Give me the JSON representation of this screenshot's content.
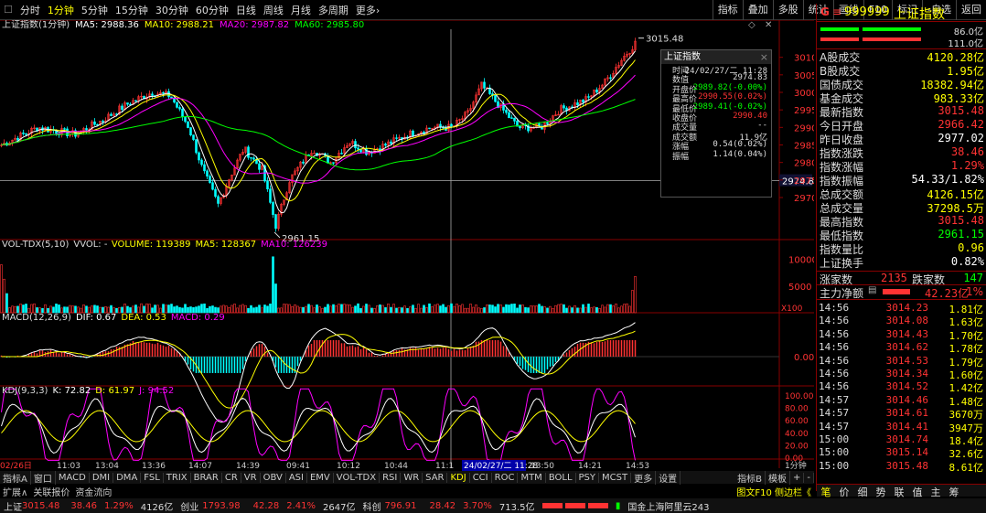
{
  "toolbar": {
    "periods": [
      "分时",
      "1分钟",
      "5分钟",
      "15分钟",
      "30分钟",
      "60分钟",
      "日线",
      "周线",
      "月线",
      "多周期",
      "更多›"
    ],
    "tools": [
      "指标",
      "叠加",
      "多股",
      "统计",
      "画线",
      "F10",
      "标记",
      "-自选",
      "返回"
    ]
  },
  "main_chart": {
    "title": "上证指数(1分钟)",
    "ma5": "MA5: 2988.36",
    "ma10": "MA10: 2988.21",
    "ma20": "MA20: 2987.82",
    "ma60": "MA60: 2985.80",
    "high_label": "3015.48",
    "low_label": "2961.15",
    "cursor_price": "2974.8",
    "y_ticks": [
      "3010",
      "3005",
      "3000",
      "2995",
      "2990",
      "2985",
      "2980",
      "2975",
      "2970"
    ]
  },
  "vol": {
    "title": "VOL-TDX(5,10)",
    "vvol": "VVOL: -",
    "volume": "VOLUME: 119389",
    "ma5": "MA5: 128367",
    "ma10": "MA10: 126239",
    "y_ticks": [
      "10000",
      "5000"
    ],
    "unit": "X100"
  },
  "macd": {
    "title": "MACD(12,26,9)",
    "dif": "DIF: 0.67",
    "dea": "DEA: 0.53",
    "macd": "MACD: 0.29",
    "y_ticks": [
      "0.00"
    ]
  },
  "kdj": {
    "title": "KDJ(9,3,3)",
    "k": "K: 72.82",
    "d": "D: 61.97",
    "j": "J: 94.52",
    "y_ticks": [
      "100.00",
      "80.00",
      "60.00",
      "40.00",
      "20.00",
      "0.00"
    ]
  },
  "time_axis": {
    "labels": [
      "02/26日",
      "11:03",
      "13:04",
      "13:36",
      "14:07",
      "14:39",
      "09:41",
      "10:12",
      "10:44",
      "11:1",
      "24/02/27/二 11:28",
      "13:50",
      "14:21",
      "14:53"
    ],
    "period": "1分钟"
  },
  "tooltip": {
    "title": "上证指数",
    "rows": [
      {
        "k": "时间",
        "v": "24/02/27/二 11:28",
        "c": "#ddd"
      },
      {
        "k": "数值",
        "v": "2974.83",
        "c": "#ddd"
      },
      {
        "k": "开盘价",
        "v": "2989.82(-0.00%)",
        "c": "#0f0"
      },
      {
        "k": "最高价",
        "v": "2990.55(0.02%)",
        "c": "#f33"
      },
      {
        "k": "最低价",
        "v": "2989.41(-0.02%)",
        "c": "#0f0"
      },
      {
        "k": "收盘价",
        "v": "2990.40",
        "c": "#f33"
      },
      {
        "k": "成交量",
        "v": "--",
        "c": "#ddd"
      },
      {
        "k": "成交额",
        "v": "11.9亿",
        "c": "#ddd"
      },
      {
        "k": "涨幅",
        "v": "0.54(0.02%)",
        "c": "#ddd"
      },
      {
        "k": "振幅",
        "v": "1.14(0.04%)",
        "c": "#ddd"
      }
    ]
  },
  "right_panel": {
    "code": "999999",
    "name": "上证指数",
    "ratio_top": "86.0亿",
    "ratio_bottom": "111.0亿",
    "stats": [
      {
        "k": "A股成交",
        "v": "4120.28亿",
        "c": "#ff0"
      },
      {
        "k": "B股成交",
        "v": "1.95亿",
        "c": "#ff0"
      },
      {
        "k": "国债成交",
        "v": "18382.94亿",
        "c": "#ff0"
      },
      {
        "k": "基金成交",
        "v": "983.33亿",
        "c": "#ff0"
      },
      {
        "k": "最新指数",
        "v": "3015.48",
        "c": "#f33"
      },
      {
        "k": "今日开盘",
        "v": "2966.42",
        "c": "#f33"
      },
      {
        "k": "昨日收盘",
        "v": "2977.02",
        "c": "#fff"
      },
      {
        "k": "指数涨跌",
        "v": "38.46",
        "c": "#f33"
      },
      {
        "k": "指数涨幅",
        "v": "1.29%",
        "c": "#f33"
      },
      {
        "k": "指数振幅",
        "v": "54.33/1.82%",
        "c": "#fff"
      },
      {
        "k": "总成交额",
        "v": "4126.15亿",
        "c": "#ff0"
      },
      {
        "k": "总成交量",
        "v": "37298.5万",
        "c": "#ff0"
      },
      {
        "k": "最高指数",
        "v": "3015.48",
        "c": "#f33"
      },
      {
        "k": "最低指数",
        "v": "2961.15",
        "c": "#0f0"
      },
      {
        "k": "指数量比",
        "v": "0.96",
        "c": "#ff0"
      },
      {
        "k": "上证换手",
        "v": "0.82%",
        "c": "#fff"
      }
    ],
    "up_label": "涨家数",
    "up": "2135",
    "down_label": "跌家数",
    "down": "147",
    "main_flow_label": "主力净额",
    "main_flow": "42.23亿",
    "main_flow_pct": "1%",
    "ticks": [
      {
        "t": "14:56",
        "p": "3014.23",
        "v": "1.81亿"
      },
      {
        "t": "14:56",
        "p": "3014.08",
        "v": "1.63亿"
      },
      {
        "t": "14:56",
        "p": "3014.43",
        "v": "1.70亿"
      },
      {
        "t": "14:56",
        "p": "3014.62",
        "v": "1.78亿"
      },
      {
        "t": "14:56",
        "p": "3014.53",
        "v": "1.79亿"
      },
      {
        "t": "14:56",
        "p": "3014.34",
        "v": "1.60亿"
      },
      {
        "t": "14:56",
        "p": "3014.52",
        "v": "1.42亿"
      },
      {
        "t": "14:57",
        "p": "3014.46",
        "v": "1.48亿"
      },
      {
        "t": "14:57",
        "p": "3014.61",
        "v": "3670万"
      },
      {
        "t": "14:57",
        "p": "3014.41",
        "v": "3947万"
      },
      {
        "t": "15:00",
        "p": "3014.74",
        "v": "18.4亿"
      },
      {
        "t": "15:00",
        "p": "3015.14",
        "v": "32.6亿"
      },
      {
        "t": "15:00",
        "p": "3015.48",
        "v": "8.61亿"
      }
    ],
    "bottom_tabs": [
      "笔",
      "价",
      "细",
      "势",
      "联",
      "值",
      "主",
      "筹"
    ]
  },
  "indicator_tabs": [
    "指标A",
    "窗口",
    "MACD",
    "DMI",
    "DMA",
    "FSL",
    "TRIX",
    "BRAR",
    "CR",
    "VR",
    "OBV",
    "ASI",
    "EMV",
    "VOL-TDX",
    "RSI",
    "WR",
    "SAR",
    "KDJ",
    "CCI",
    "ROC",
    "MTM",
    "BOLL",
    "PSY",
    "MCST",
    "更多",
    "设置"
  ],
  "indicator_right": [
    "指标B",
    "模板",
    "+",
    "-"
  ],
  "sub_tabs": [
    "扩展∧",
    "关联报价",
    "资金流向"
  ],
  "sub_right": "图文F10 侧边栏《",
  "status": {
    "sh": "上证",
    "sh_v": "3015.48",
    "sh_c": "38.46",
    "sh_p": "1.29%",
    "sh_a": "4126亿",
    "cy": "创业",
    "cy_v": "1793.98",
    "cy_c": "42.28",
    "cy_p": "2.41%",
    "cy_a": "2647亿",
    "kc": "科创",
    "kc_v": "796.91",
    "kc_c": "28.42",
    "kc_p": "3.70%",
    "kc_a": "713.5亿",
    "server": "国金上海阿里云243"
  },
  "colors": {
    "up": "#ff3333",
    "down": "#00ffff",
    "ma5": "#ffffff",
    "ma10": "#ffff00",
    "ma20": "#ff00ff",
    "ma60": "#00ff00"
  }
}
